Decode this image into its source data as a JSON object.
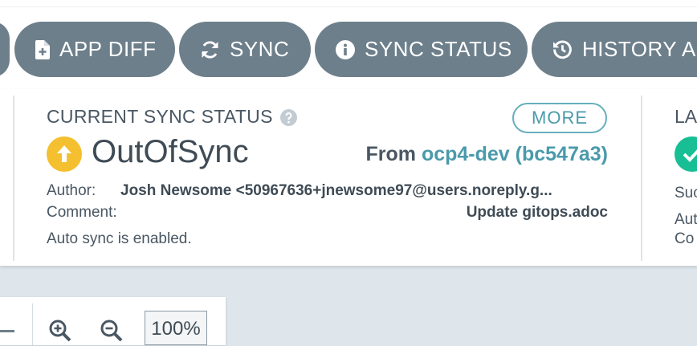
{
  "toolbar": {
    "buttons": [
      {
        "label": "APP DIFF",
        "icon": "file-plus-icon"
      },
      {
        "label": "SYNC",
        "icon": "sync-icon"
      },
      {
        "label": "SYNC STATUS",
        "icon": "info-circle-icon"
      },
      {
        "label": "HISTORY AN",
        "icon": "history-icon"
      }
    ]
  },
  "sync_status": {
    "heading": "CURRENT SYNC STATUS",
    "more_label": "MORE",
    "status": "OutOfSync",
    "from_label": "From",
    "revision": "ocp4-dev (bc547a3)",
    "author_label": "Author:",
    "author_value": "Josh Newsome <50967636+jnewsome97@users.noreply.g...",
    "comment_label": "Comment:",
    "comment_value": "Update gitops.adoc",
    "auto_sync": "Auto sync is enabled.",
    "status_color": "#f4c030"
  },
  "last_sync": {
    "heading_partial": "LA",
    "line1_partial": "Suc",
    "line2_partial": "Aut",
    "line3_partial": "Co",
    "status_color": "#18be94"
  },
  "zoom": {
    "level": "100%"
  }
}
